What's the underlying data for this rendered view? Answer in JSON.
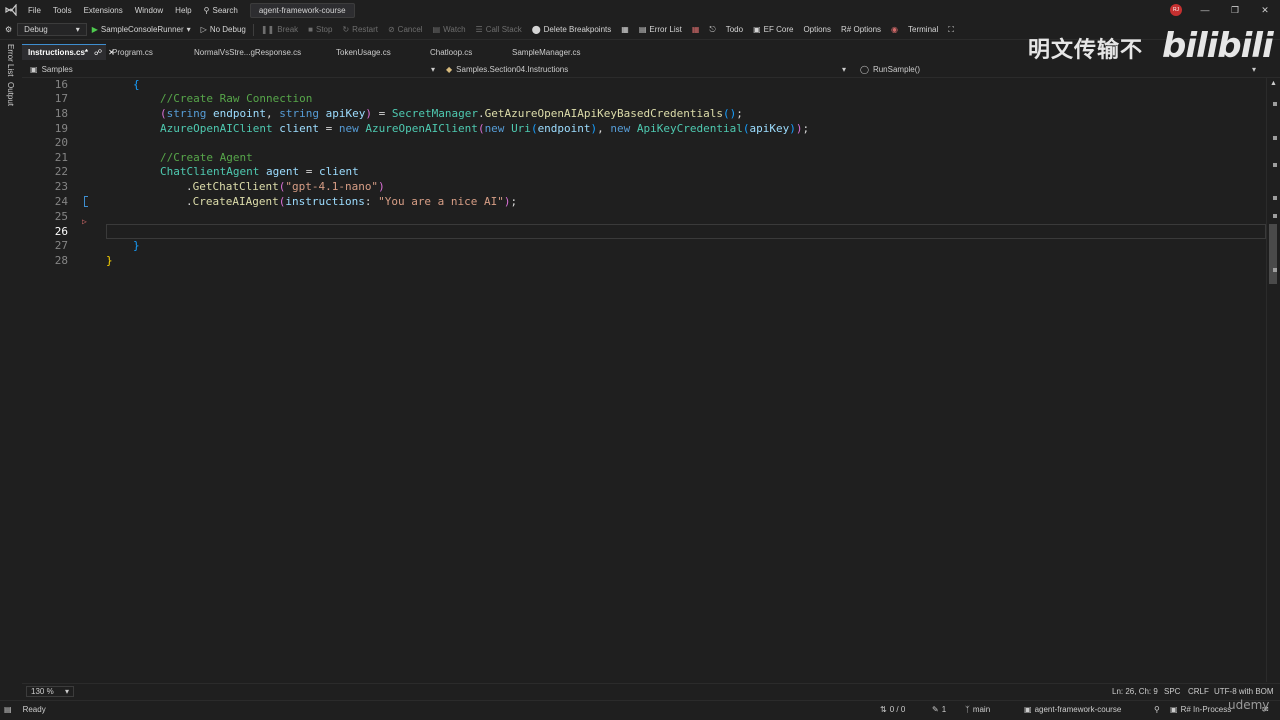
{
  "menu": {
    "items": [
      "File",
      "Tools",
      "Extensions",
      "Window",
      "Help"
    ],
    "search_label": "Search",
    "project": "agent-framework-course",
    "avatar": "RJ"
  },
  "toolbar": {
    "config": "Debug",
    "run_target": "SampleConsoleRunner",
    "no_debug": "No Debug",
    "break": "Break",
    "stop": "Stop",
    "restart": "Restart",
    "cancel": "Cancel",
    "watch": "Watch",
    "call_stack": "Call Stack",
    "delete_breakpoints": "Delete Breakpoints",
    "error_list": "Error List",
    "todo": "Todo",
    "ef_core": "EF Core",
    "options": "Options",
    "rs_options": "R# Options",
    "terminal": "Terminal"
  },
  "side_tabs": [
    "Error List",
    "Output"
  ],
  "tabs": [
    {
      "label": "Instructions.cs*",
      "active": true
    },
    {
      "label": "Program.cs"
    },
    {
      "label": "NormalVsStre...gResponse.cs"
    },
    {
      "label": "TokenUsage.cs"
    },
    {
      "label": "Chatloop.cs"
    },
    {
      "label": "SampleManager.cs"
    }
  ],
  "navbar": {
    "project": "Samples",
    "type": "Samples.Section04.Instructions",
    "member": "RunSample()"
  },
  "editor": {
    "line_numbers": [
      "16",
      "17",
      "18",
      "19",
      "20",
      "21",
      "22",
      "23",
      "24",
      "25",
      "26",
      "27",
      "28"
    ],
    "current_line": "26"
  },
  "editor_status": {
    "zoom": "130 %",
    "position": "Ln: 26, Ch: 9",
    "whitespace": "SPC",
    "line_endings": "CRLF",
    "encoding": "UTF-8 with BOM"
  },
  "status": {
    "ready": "Ready",
    "sync": "0 / 0",
    "pencil_count": "1",
    "branch": "main",
    "repo": "agent-framework-course",
    "resharper": "R# In-Process"
  },
  "watermark": {
    "text": "明文传输不",
    "logo": "bilibili",
    "udemy": "udemy"
  }
}
